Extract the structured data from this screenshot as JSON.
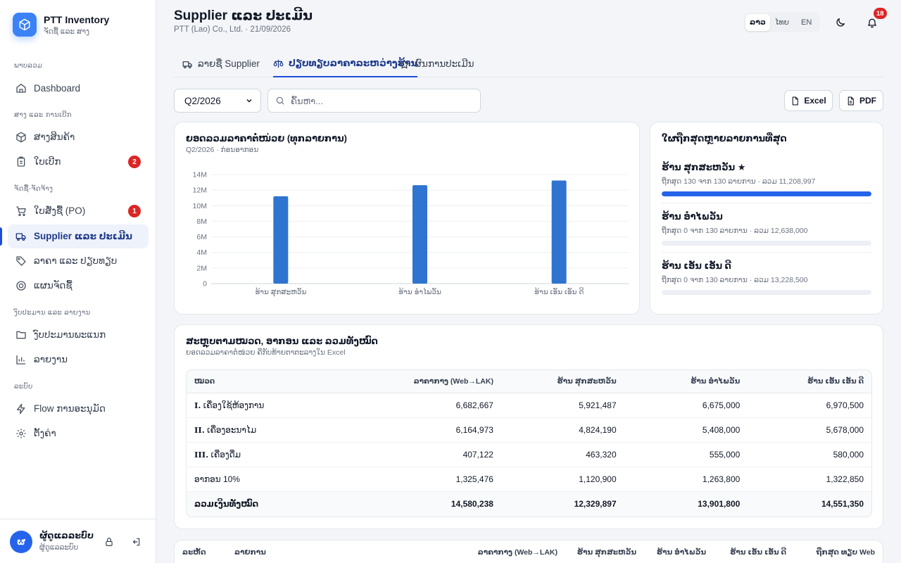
{
  "brand": {
    "title": "PTT Inventory",
    "subtitle": "ຈັດຊື້ ແລະ ສາງ"
  },
  "sidebar": {
    "sections": [
      {
        "label": "ພາບລວມ"
      },
      {
        "label": "ສາງ ແລະ ການເບີກ"
      },
      {
        "label": "ຈັດຊື້-ຈັດຈ້າງ"
      },
      {
        "label": "ງົບປະມານ ແລະ ລາຍງານ"
      },
      {
        "label": "ລະບົບ"
      }
    ],
    "items": [
      {
        "label": "Dashboard",
        "icon": "home-icon"
      },
      {
        "label": "ສາງສິນຄ້າ",
        "icon": "box-icon"
      },
      {
        "label": "ໃບເບີກ",
        "icon": "clipboard-icon",
        "badge": "2"
      },
      {
        "label": "ໃບສັ່ງຊື້ (PO)",
        "icon": "cart-icon",
        "badge": "1"
      },
      {
        "label": "Supplier ແລະ ປະເມີນ",
        "icon": "truck-icon",
        "active": true
      },
      {
        "label": "ລາຄາ ແລະ ປຽບທຽບ",
        "icon": "tag-icon"
      },
      {
        "label": "ແຜນຈັດຊື້",
        "icon": "target-icon"
      },
      {
        "label": "ງົບປະມານພະແນກ",
        "icon": "folder-icon"
      },
      {
        "label": "ລາຍງານ",
        "icon": "bar-chart-icon"
      },
      {
        "label": "Flow ການອະນຸມັດ",
        "icon": "bolt-icon"
      },
      {
        "label": "ຕັ້ງຄ່າ",
        "icon": "gear-icon"
      }
    ]
  },
  "user": {
    "initial": "ຜ",
    "name": "ຜູ້ດູແລລະບົບ",
    "role": "ຜູ້ດູແລລະບົບ"
  },
  "header": {
    "title": "Supplier ແລະ ປະເມີນ",
    "subtitle": "PTT (Lao) Co., Ltd. · 21/09/2026",
    "languages": [
      "ລາວ",
      "ໄທຍ",
      "EN"
    ],
    "active_language": "ລາວ",
    "notification_count": "18"
  },
  "tabs": [
    {
      "label": "ລາຍຊື່ Supplier",
      "icon": "truck-icon"
    },
    {
      "label": "ປຽບທຽບລາຄາລະຫວ່າງຮ້ານ",
      "icon": "scale-icon",
      "active": true
    },
    {
      "label": "ຜົນການປະເມີນ",
      "icon": "star-icon"
    }
  ],
  "toolbar": {
    "period": "Q2/2026",
    "search_placeholder": "ຄົ້ນຫາ...",
    "excel_label": "Excel",
    "pdf_label": "PDF"
  },
  "chart_card": {
    "title": "ຍອດລວມລາຄາຕໍ່ໜ່ວຍ (ທຸກລາຍການ)",
    "subtitle": "Q2/2026 · ກ່ອນອາກອນ"
  },
  "chart_data": {
    "type": "bar",
    "categories": [
      "ຮ້ານ ສຸກສະຫວັນ",
      "ຮ້ານ ອຳໄພວັນ",
      "ຮ້ານ ເອັນ ເອັນ ດີ"
    ],
    "values": [
      11208997,
      12638000,
      13228500
    ],
    "y_ticks": [
      "0",
      "2M",
      "4M",
      "6M",
      "8M",
      "10M",
      "12M",
      "14M"
    ],
    "ylim": [
      0,
      14000000
    ],
    "grid": true,
    "color": "#2f74d0"
  },
  "best_card": {
    "title": "ໃຜຖືກສຸດຫຼາຍລາຍການທີ່ສຸດ",
    "stores": [
      {
        "name": "ຮ້ານ ສຸກສະຫວັນ ★",
        "meta": "ຖືກສຸດ 130 ຈາກ 130 ລາຍການ · ລວມ 11,208,997",
        "share": 1.0
      },
      {
        "name": "ຮ້ານ ອຳໄພວັນ",
        "meta": "ຖືກສຸດ 0 ຈາກ 130 ລາຍການ · ລວມ 12,638,000",
        "share": 0
      },
      {
        "name": "ຮ້ານ ເອັນ ເອັນ ດີ",
        "meta": "ຖືກສຸດ 0 ຈາກ 130 ລາຍການ · ລວມ 13,228,500",
        "share": 0
      }
    ]
  },
  "summary": {
    "title": "ສະຫຼຸບຕາມໝວດ, ອາກອນ ແລະ ລວມທັງໝົດ",
    "subtitle": "ຍອດລວມລາຄາຕໍ່ໜ່ວຍ ຄືກັບທ້າຍຕາຕະລາງໃນ Excel",
    "columns": [
      "ໝວດ",
      "ລາຄາກາງ (Web→LAK)",
      "ຮ້ານ ສຸກສະຫວັນ",
      "ຮ້ານ ອຳໄພວັນ",
      "ຮ້ານ ເອັນ ເອັນ ດີ"
    ],
    "rows": [
      {
        "num": "I.",
        "label": "ເຄື່ອງໃຊ້ຫ້ອງການ",
        "values": [
          "6,682,667",
          "5,921,487",
          "6,675,000",
          "6,970,500"
        ]
      },
      {
        "num": "II.",
        "label": "ເຄື່ອງອະນາໄມ",
        "values": [
          "6,164,973",
          "4,824,190",
          "5,408,000",
          "5,678,000"
        ]
      },
      {
        "num": "III.",
        "label": "ເຄື່ອງດື່ມ",
        "values": [
          "407,122",
          "463,320",
          "555,000",
          "580,000"
        ]
      },
      {
        "num": "",
        "label": "ອາກອນ 10%",
        "values": [
          "1,325,476",
          "1,120,900",
          "1,263,800",
          "1,322,850"
        ]
      }
    ],
    "total": {
      "label": "ລວມເງິນທັງໝົດ",
      "values": [
        "14,580,238",
        "12,329,897",
        "13,901,800",
        "14,551,350"
      ]
    }
  },
  "detail_table": {
    "columns": [
      "ລະຫັດ",
      "ລາຍການ",
      "ລາຄາກາງ (Web→LAK)",
      "ຮ້ານ ສຸກສະຫວັນ",
      "ຮ້ານ ອຳໄພວັນ",
      "ຮ້ານ ເອັນ ເອັນ ດີ",
      "ຖືກສຸດ ທຽບ Web"
    ]
  }
}
